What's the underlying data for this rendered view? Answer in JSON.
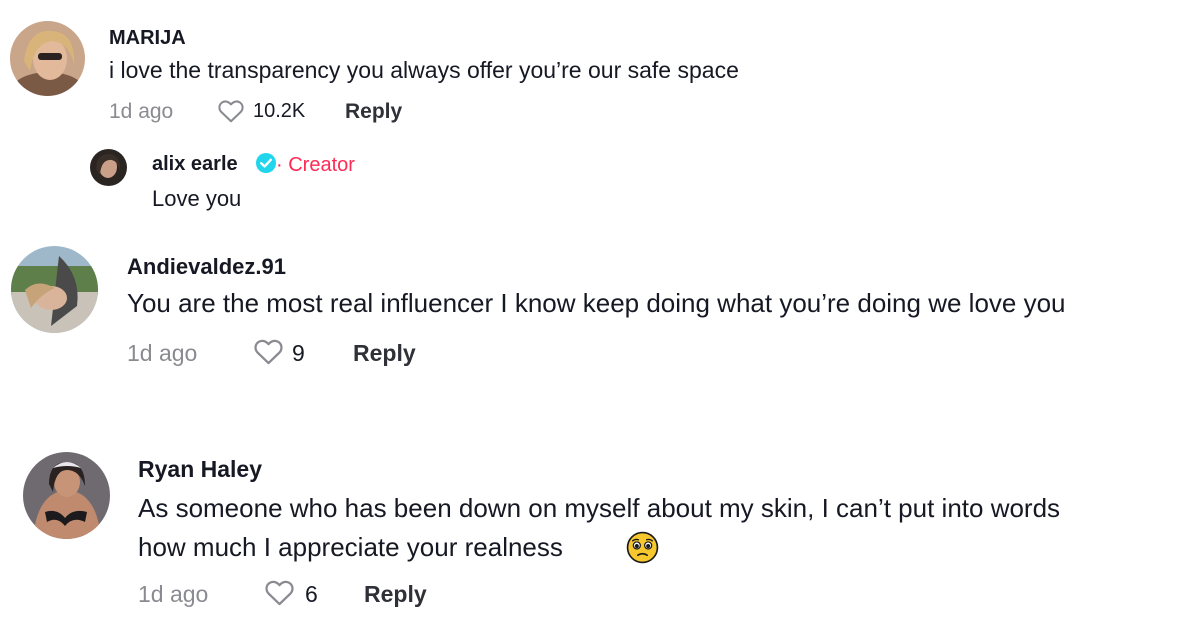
{
  "comments": [
    {
      "username": "MARIJA",
      "text": "i love the transparency you always offer you’re our safe space",
      "time": "1d ago",
      "likes": "10.2K",
      "reply_label": "Reply"
    },
    {
      "username": "Andievaldez.91",
      "text": "You are the most real influencer I know keep doing what you’re doing we love you",
      "time": "1d ago",
      "likes": "9",
      "reply_label": "Reply"
    },
    {
      "username": "Ryan Haley",
      "text_line1": "As someone who has been down on myself about my skin, I can’t put into words",
      "text_line2": "how much I appreciate your realness",
      "time": "1d ago",
      "likes": "6",
      "reply_label": "Reply"
    }
  ],
  "creator_reply": {
    "username": "alix earle",
    "creator_label": "· Creator",
    "text": "Love you"
  },
  "colors": {
    "creator_accent": "#fe2c55",
    "verified_blue": "#20d5ec",
    "muted_text": "#8a8b91"
  },
  "icons": {
    "like": "heart-outline-icon",
    "verified": "verified-badge-icon",
    "emoji": "pleading-face-emoji"
  }
}
